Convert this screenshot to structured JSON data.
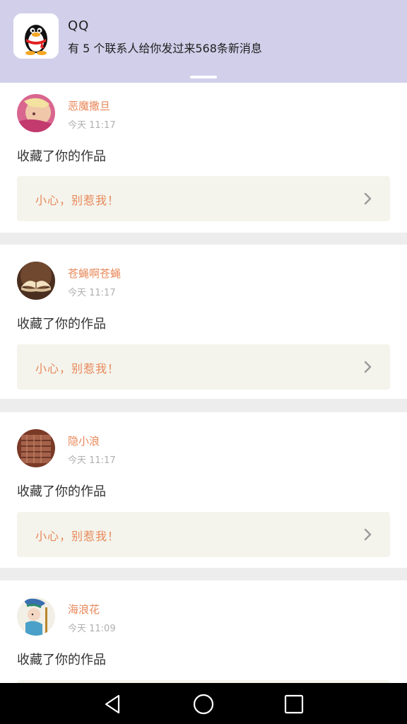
{
  "notification": {
    "app_name": "QQ",
    "message": "有 5 个联系人给你发过来568条新消息"
  },
  "feed": [
    {
      "username": "恶魔撒旦",
      "time": "今天 11:17",
      "action": "收藏了你的作品",
      "quote": "小心，别惹我！"
    },
    {
      "username": "苍蝇啊苍蝇",
      "time": "今天 11:17",
      "action": "收藏了你的作品",
      "quote": "小心，别惹我！"
    },
    {
      "username": "隐小浪",
      "time": "今天 11:17",
      "action": "收藏了你的作品",
      "quote": "小心，别惹我！"
    },
    {
      "username": "海浪花",
      "time": "今天 11:09",
      "action": "收藏了你的作品"
    }
  ],
  "colors": {
    "notification_bg": "#d1cfea",
    "accent_orange": "#e8885a",
    "quote_bg": "#f4f4ec",
    "separator": "#ededed"
  },
  "icons": {
    "notification_app": "qq-penguin-icon",
    "quote_arrow": "chevron-right-icon",
    "nav_back": "back-triangle-icon",
    "nav_home": "home-circle-icon",
    "nav_recents": "recents-square-icon"
  }
}
